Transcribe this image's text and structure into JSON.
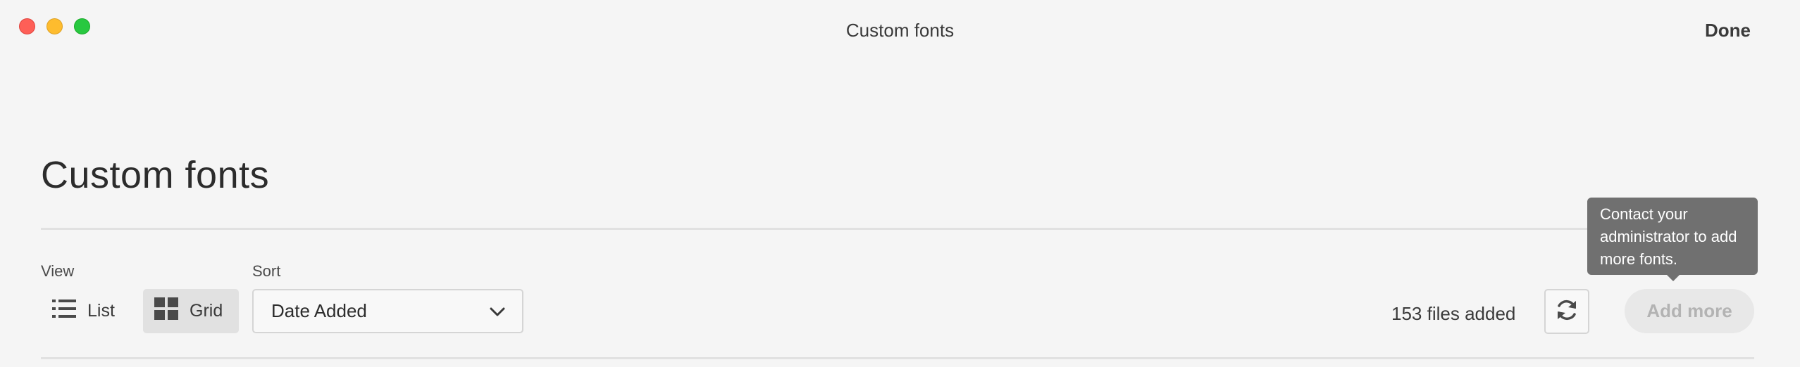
{
  "window": {
    "title": "Custom fonts",
    "done_label": "Done"
  },
  "page": {
    "title": "Custom fonts"
  },
  "view": {
    "label": "View",
    "options": [
      "List",
      "Grid"
    ],
    "selected": "Grid"
  },
  "sort": {
    "label": "Sort",
    "selected": "Date Added"
  },
  "status": {
    "files_added": "153 files added"
  },
  "actions": {
    "add_more_label": "Add more",
    "add_more_disabled": true,
    "tooltip": "Contact your administrator to add more fonts."
  },
  "icons": {
    "list": "list-icon",
    "grid": "grid-icon",
    "chevron": "chevron-down-icon",
    "refresh": "refresh-icon"
  },
  "colors": {
    "close": "#fe5f57",
    "minimize": "#febc2e",
    "maximize": "#28c840",
    "tooltip_bg": "#707070",
    "selected_bg": "#e1e1e1"
  }
}
